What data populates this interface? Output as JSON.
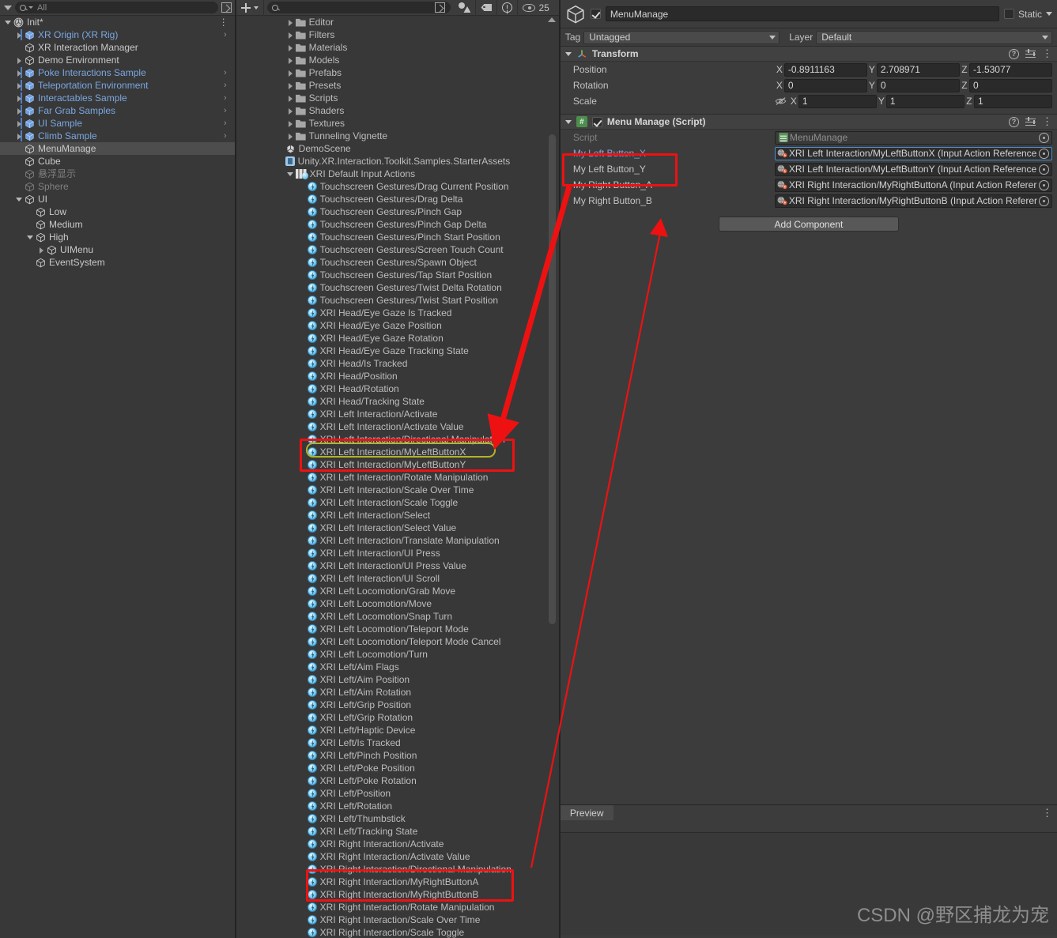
{
  "hierarchy": {
    "search_placeholder": "All",
    "scene_root": {
      "label": "Init*",
      "icon": "unity-scene-icon"
    },
    "items": [
      {
        "label": "XR Origin (XR Rig)",
        "indent": 1,
        "twisty": "right",
        "color": "blue",
        "prefab": true,
        "chevron": ">"
      },
      {
        "label": "XR Interaction Manager",
        "indent": 1,
        "twisty": "none",
        "color": "white",
        "prefab": false,
        "chevron": ""
      },
      {
        "label": "Demo Environment",
        "indent": 1,
        "twisty": "right",
        "color": "white",
        "prefab": false,
        "chevron": ""
      },
      {
        "label": "Poke Interactions Sample",
        "indent": 1,
        "twisty": "right",
        "color": "blue",
        "prefab": true,
        "chevron": ">"
      },
      {
        "label": "Teleportation Environment",
        "indent": 1,
        "twisty": "right",
        "color": "blue",
        "prefab": true,
        "chevron": ">"
      },
      {
        "label": "Interactables Sample",
        "indent": 1,
        "twisty": "right",
        "color": "blue",
        "prefab": true,
        "chevron": ">"
      },
      {
        "label": "Far Grab Samples",
        "indent": 1,
        "twisty": "right",
        "color": "blue",
        "prefab": true,
        "chevron": ">"
      },
      {
        "label": "UI Sample",
        "indent": 1,
        "twisty": "right",
        "color": "blue",
        "prefab": true,
        "chevron": ">"
      },
      {
        "label": "Climb Sample",
        "indent": 1,
        "twisty": "right",
        "color": "blue",
        "prefab": true,
        "chevron": ">"
      },
      {
        "label": "MenuManage",
        "indent": 1,
        "twisty": "none",
        "color": "white",
        "prefab": false,
        "chevron": "",
        "selected": true
      },
      {
        "label": "Cube",
        "indent": 1,
        "twisty": "none",
        "color": "white",
        "prefab": false,
        "chevron": ""
      },
      {
        "label": "悬浮显示",
        "indent": 1,
        "twisty": "none",
        "color": "dim",
        "prefab": false,
        "chevron": ""
      },
      {
        "label": "Sphere",
        "indent": 1,
        "twisty": "none",
        "color": "dim",
        "prefab": false,
        "chevron": ""
      },
      {
        "label": "UI",
        "indent": 1,
        "twisty": "down",
        "color": "white",
        "prefab": false,
        "chevron": ""
      },
      {
        "label": "Low",
        "indent": 2,
        "twisty": "none",
        "color": "white",
        "prefab": false,
        "chevron": ""
      },
      {
        "label": "Medium",
        "indent": 2,
        "twisty": "none",
        "color": "white",
        "prefab": false,
        "chevron": ""
      },
      {
        "label": "High",
        "indent": 2,
        "twisty": "down",
        "color": "white",
        "prefab": false,
        "chevron": ""
      },
      {
        "label": "UIMenu",
        "indent": 3,
        "twisty": "right",
        "color": "white",
        "prefab": false,
        "chevron": ""
      },
      {
        "label": "EventSystem",
        "indent": 2,
        "twisty": "none",
        "color": "white",
        "prefab": false,
        "chevron": ""
      }
    ]
  },
  "project": {
    "search_placeholder": "",
    "visibility_count": "25",
    "items": [
      {
        "label": "Editor",
        "kind": "folder",
        "indent": 1,
        "twisty": "right"
      },
      {
        "label": "Filters",
        "kind": "folder",
        "indent": 1,
        "twisty": "right"
      },
      {
        "label": "Materials",
        "kind": "folder",
        "indent": 1,
        "twisty": "right"
      },
      {
        "label": "Models",
        "kind": "folder",
        "indent": 1,
        "twisty": "right"
      },
      {
        "label": "Prefabs",
        "kind": "folder",
        "indent": 1,
        "twisty": "right"
      },
      {
        "label": "Presets",
        "kind": "folder",
        "indent": 1,
        "twisty": "right"
      },
      {
        "label": "Scripts",
        "kind": "folder",
        "indent": 1,
        "twisty": "right"
      },
      {
        "label": "Shaders",
        "kind": "folder",
        "indent": 1,
        "twisty": "right"
      },
      {
        "label": "Textures",
        "kind": "folder",
        "indent": 1,
        "twisty": "right"
      },
      {
        "label": "Tunneling Vignette",
        "kind": "folder",
        "indent": 1,
        "twisty": "right"
      },
      {
        "label": "DemoScene",
        "kind": "scene",
        "indent": 1,
        "twisty": "none"
      },
      {
        "label": "Unity.XR.Interaction.Toolkit.Samples.StarterAssets",
        "kind": "asmdef",
        "indent": 1,
        "twisty": "none"
      },
      {
        "label": "XRI Default Input Actions",
        "kind": "inputactions",
        "indent": 1,
        "twisty": "down"
      },
      {
        "label": "Touchscreen Gestures/Drag Current Position",
        "kind": "action",
        "indent": 2,
        "twisty": "none"
      },
      {
        "label": "Touchscreen Gestures/Drag Delta",
        "kind": "action",
        "indent": 2,
        "twisty": "none"
      },
      {
        "label": "Touchscreen Gestures/Pinch Gap",
        "kind": "action",
        "indent": 2,
        "twisty": "none"
      },
      {
        "label": "Touchscreen Gestures/Pinch Gap Delta",
        "kind": "action",
        "indent": 2,
        "twisty": "none"
      },
      {
        "label": "Touchscreen Gestures/Pinch Start Position",
        "kind": "action",
        "indent": 2,
        "twisty": "none"
      },
      {
        "label": "Touchscreen Gestures/Screen Touch Count",
        "kind": "action",
        "indent": 2,
        "twisty": "none"
      },
      {
        "label": "Touchscreen Gestures/Spawn Object",
        "kind": "action",
        "indent": 2,
        "twisty": "none"
      },
      {
        "label": "Touchscreen Gestures/Tap Start Position",
        "kind": "action",
        "indent": 2,
        "twisty": "none"
      },
      {
        "label": "Touchscreen Gestures/Twist Delta Rotation",
        "kind": "action",
        "indent": 2,
        "twisty": "none"
      },
      {
        "label": "Touchscreen Gestures/Twist Start Position",
        "kind": "action",
        "indent": 2,
        "twisty": "none"
      },
      {
        "label": "XRI Head/Eye Gaze Is Tracked",
        "kind": "action",
        "indent": 2,
        "twisty": "none"
      },
      {
        "label": "XRI Head/Eye Gaze Position",
        "kind": "action",
        "indent": 2,
        "twisty": "none"
      },
      {
        "label": "XRI Head/Eye Gaze Rotation",
        "kind": "action",
        "indent": 2,
        "twisty": "none"
      },
      {
        "label": "XRI Head/Eye Gaze Tracking State",
        "kind": "action",
        "indent": 2,
        "twisty": "none"
      },
      {
        "label": "XRI Head/Is Tracked",
        "kind": "action",
        "indent": 2,
        "twisty": "none"
      },
      {
        "label": "XRI Head/Position",
        "kind": "action",
        "indent": 2,
        "twisty": "none"
      },
      {
        "label": "XRI Head/Rotation",
        "kind": "action",
        "indent": 2,
        "twisty": "none"
      },
      {
        "label": "XRI Head/Tracking State",
        "kind": "action",
        "indent": 2,
        "twisty": "none"
      },
      {
        "label": "XRI Left Interaction/Activate",
        "kind": "action",
        "indent": 2,
        "twisty": "none"
      },
      {
        "label": "XRI Left Interaction/Activate Value",
        "kind": "action",
        "indent": 2,
        "twisty": "none"
      },
      {
        "label": "XRI Left Interaction/Directional Manipulation",
        "kind": "action",
        "indent": 2,
        "twisty": "none"
      },
      {
        "label": "XRI Left Interaction/MyLeftButtonX",
        "kind": "action",
        "indent": 2,
        "twisty": "none",
        "highlighted": true
      },
      {
        "label": "XRI Left Interaction/MyLeftButtonY",
        "kind": "action",
        "indent": 2,
        "twisty": "none"
      },
      {
        "label": "XRI Left Interaction/Rotate Manipulation",
        "kind": "action",
        "indent": 2,
        "twisty": "none"
      },
      {
        "label": "XRI Left Interaction/Scale Over Time",
        "kind": "action",
        "indent": 2,
        "twisty": "none"
      },
      {
        "label": "XRI Left Interaction/Scale Toggle",
        "kind": "action",
        "indent": 2,
        "twisty": "none"
      },
      {
        "label": "XRI Left Interaction/Select",
        "kind": "action",
        "indent": 2,
        "twisty": "none"
      },
      {
        "label": "XRI Left Interaction/Select Value",
        "kind": "action",
        "indent": 2,
        "twisty": "none"
      },
      {
        "label": "XRI Left Interaction/Translate Manipulation",
        "kind": "action",
        "indent": 2,
        "twisty": "none"
      },
      {
        "label": "XRI Left Interaction/UI Press",
        "kind": "action",
        "indent": 2,
        "twisty": "none"
      },
      {
        "label": "XRI Left Interaction/UI Press Value",
        "kind": "action",
        "indent": 2,
        "twisty": "none"
      },
      {
        "label": "XRI Left Interaction/UI Scroll",
        "kind": "action",
        "indent": 2,
        "twisty": "none"
      },
      {
        "label": "XRI Left Locomotion/Grab Move",
        "kind": "action",
        "indent": 2,
        "twisty": "none"
      },
      {
        "label": "XRI Left Locomotion/Move",
        "kind": "action",
        "indent": 2,
        "twisty": "none"
      },
      {
        "label": "XRI Left Locomotion/Snap Turn",
        "kind": "action",
        "indent": 2,
        "twisty": "none"
      },
      {
        "label": "XRI Left Locomotion/Teleport Mode",
        "kind": "action",
        "indent": 2,
        "twisty": "none"
      },
      {
        "label": "XRI Left Locomotion/Teleport Mode Cancel",
        "kind": "action",
        "indent": 2,
        "twisty": "none"
      },
      {
        "label": "XRI Left Locomotion/Turn",
        "kind": "action",
        "indent": 2,
        "twisty": "none"
      },
      {
        "label": "XRI Left/Aim Flags",
        "kind": "action",
        "indent": 2,
        "twisty": "none"
      },
      {
        "label": "XRI Left/Aim Position",
        "kind": "action",
        "indent": 2,
        "twisty": "none"
      },
      {
        "label": "XRI Left/Aim Rotation",
        "kind": "action",
        "indent": 2,
        "twisty": "none"
      },
      {
        "label": "XRI Left/Grip Position",
        "kind": "action",
        "indent": 2,
        "twisty": "none"
      },
      {
        "label": "XRI Left/Grip Rotation",
        "kind": "action",
        "indent": 2,
        "twisty": "none"
      },
      {
        "label": "XRI Left/Haptic Device",
        "kind": "action",
        "indent": 2,
        "twisty": "none"
      },
      {
        "label": "XRI Left/Is Tracked",
        "kind": "action",
        "indent": 2,
        "twisty": "none"
      },
      {
        "label": "XRI Left/Pinch Position",
        "kind": "action",
        "indent": 2,
        "twisty": "none"
      },
      {
        "label": "XRI Left/Poke Position",
        "kind": "action",
        "indent": 2,
        "twisty": "none"
      },
      {
        "label": "XRI Left/Poke Rotation",
        "kind": "action",
        "indent": 2,
        "twisty": "none"
      },
      {
        "label": "XRI Left/Position",
        "kind": "action",
        "indent": 2,
        "twisty": "none"
      },
      {
        "label": "XRI Left/Rotation",
        "kind": "action",
        "indent": 2,
        "twisty": "none"
      },
      {
        "label": "XRI Left/Thumbstick",
        "kind": "action",
        "indent": 2,
        "twisty": "none"
      },
      {
        "label": "XRI Left/Tracking State",
        "kind": "action",
        "indent": 2,
        "twisty": "none"
      },
      {
        "label": "XRI Right Interaction/Activate",
        "kind": "action",
        "indent": 2,
        "twisty": "none"
      },
      {
        "label": "XRI Right Interaction/Activate Value",
        "kind": "action",
        "indent": 2,
        "twisty": "none"
      },
      {
        "label": "XRI Right Interaction/Directional Manipulation",
        "kind": "action",
        "indent": 2,
        "twisty": "none"
      },
      {
        "label": "XRI Right Interaction/MyRightButtonA",
        "kind": "action",
        "indent": 2,
        "twisty": "none"
      },
      {
        "label": "XRI Right Interaction/MyRightButtonB",
        "kind": "action",
        "indent": 2,
        "twisty": "none"
      },
      {
        "label": "XRI Right Interaction/Rotate Manipulation",
        "kind": "action",
        "indent": 2,
        "twisty": "none"
      },
      {
        "label": "XRI Right Interaction/Scale Over Time",
        "kind": "action",
        "indent": 2,
        "twisty": "none"
      },
      {
        "label": "XRI Right Interaction/Scale Toggle",
        "kind": "action",
        "indent": 2,
        "twisty": "none"
      }
    ]
  },
  "inspector": {
    "object_name": "MenuManage",
    "enabled": true,
    "static_label": "Static",
    "tag_label": "Tag",
    "tag_value": "Untagged",
    "layer_label": "Layer",
    "layer_value": "Default",
    "transform": {
      "title": "Transform",
      "rows": [
        {
          "label": "Position",
          "x": "-0.8911163",
          "y": "2.708971",
          "z": "-1.53077"
        },
        {
          "label": "Rotation",
          "x": "0",
          "y": "0",
          "z": "0"
        },
        {
          "label": "Scale",
          "x": "1",
          "y": "1",
          "z": "1"
        }
      ],
      "axis_x": "X",
      "axis_y": "Y",
      "axis_z": "Z"
    },
    "script_component": {
      "title": "Menu Manage (Script)",
      "enabled": true,
      "script_row_label": "Script",
      "script_value": "MenuManage",
      "fields": [
        {
          "label": "My Left Button_X",
          "value": "XRI Left Interaction/MyLeftButtonX (Input Action Reference",
          "highlighted": true,
          "label_blue": true
        },
        {
          "label": "My Left Button_Y",
          "value": "XRI Left Interaction/MyLeftButtonY (Input Action Reference",
          "highlighted": false,
          "label_blue": false
        },
        {
          "label": "My Right Button_A",
          "value": "XRI Right Interaction/MyRightButtonA (Input Action Referer",
          "highlighted": false,
          "label_blue": false
        },
        {
          "label": "My Right Button_B",
          "value": "XRI Right Interaction/MyRightButtonB (Input Action Referer",
          "highlighted": false,
          "label_blue": false
        }
      ]
    },
    "add_component_label": "Add Component",
    "preview_tab_label": "Preview"
  },
  "watermark": "CSDN @野区捕龙为宠",
  "colors": {
    "accent_blue": "#7aa7e0",
    "annotation_red": "#ee1111",
    "annotation_yellow": "#b3b32a",
    "panel_bg": "#383838",
    "inspector_bg": "#3c3c3c",
    "selected_row": "#4d4d4d"
  }
}
